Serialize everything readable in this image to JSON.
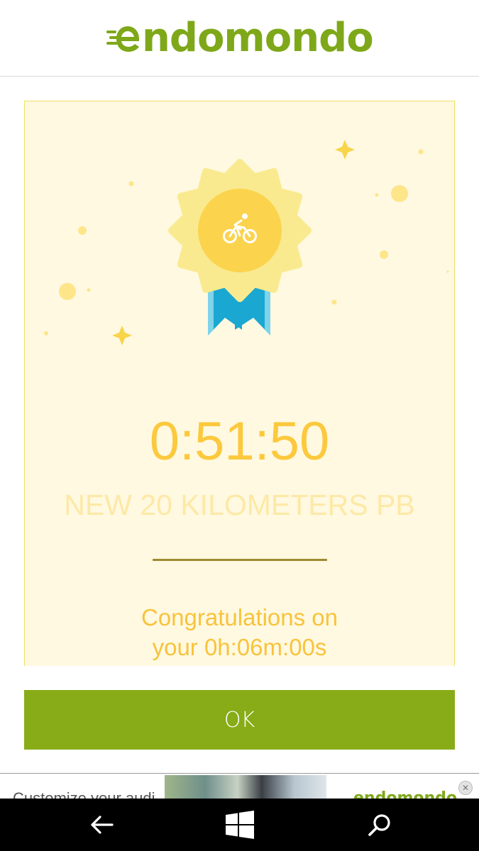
{
  "header": {
    "logo_text": "ndomondo",
    "brand_color": "#7ea819",
    "logo_icon": "endomondo-e-logo-icon"
  },
  "achievement": {
    "badge_icon": "cycling-icon",
    "time": "0:51:50",
    "title": "NEW 20 KILOMETERS PB",
    "congrats_line1": "Congratulations on",
    "congrats_line2": "your 0h:06m:00s",
    "badge_color": "#fcd34d",
    "ribbon_color": "#1aa7d1"
  },
  "ok_button": {
    "label": "OK",
    "color": "#87ac17"
  },
  "ad": {
    "text": "Customize your audi",
    "brand": "endomondo",
    "close_icon": "close-icon"
  },
  "navbar": {
    "back_icon": "back-arrow-icon",
    "home_icon": "windows-icon",
    "search_icon": "search-icon"
  }
}
